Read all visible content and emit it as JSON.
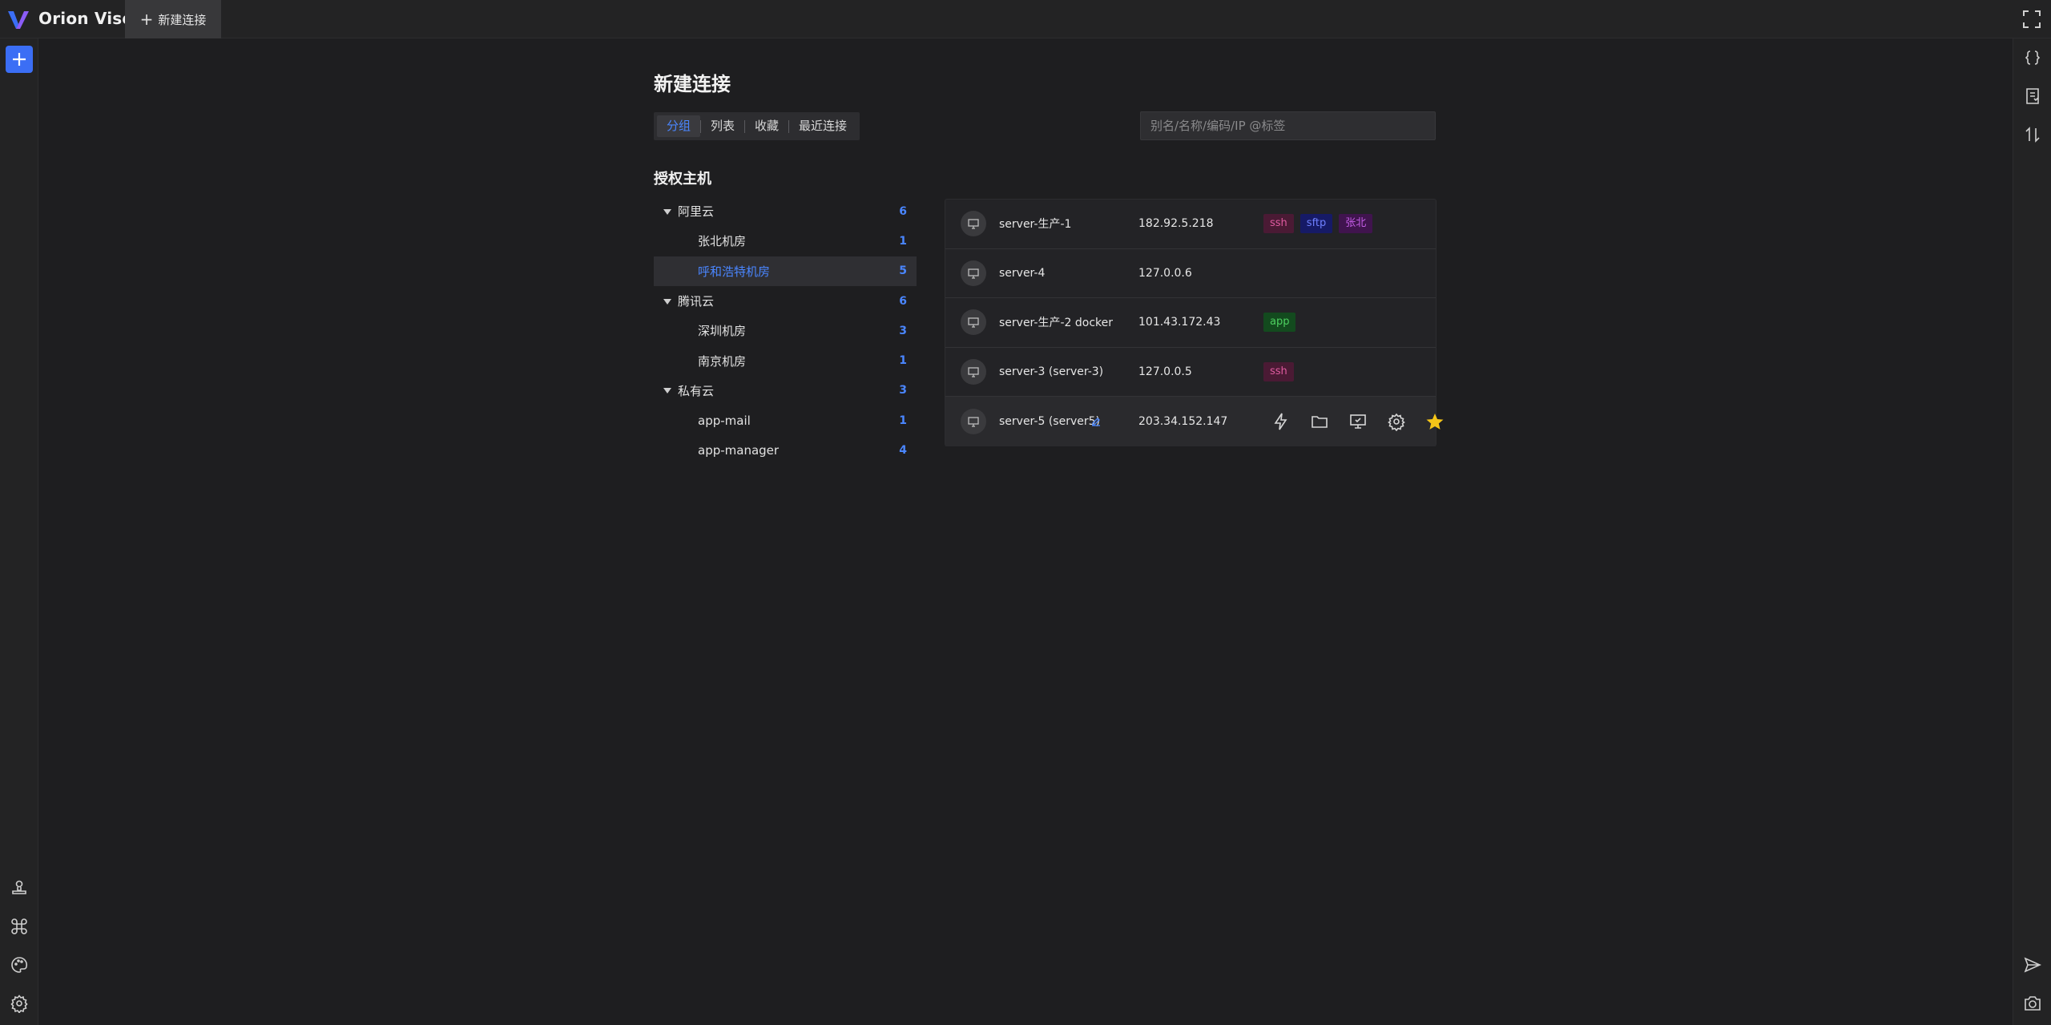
{
  "app": {
    "title": "Orion Visor"
  },
  "tabs": [
    {
      "label": "新建连接"
    }
  ],
  "page": {
    "title": "新建连接"
  },
  "view_tabs": [
    {
      "label": "分组",
      "active": true
    },
    {
      "label": "列表",
      "active": false
    },
    {
      "label": "收藏",
      "active": false
    },
    {
      "label": "最近连接",
      "active": false
    }
  ],
  "search": {
    "placeholder": "别名/名称/编码/IP @标签",
    "value": ""
  },
  "section": {
    "title": "授权主机"
  },
  "tree": [
    {
      "label": "阿里云",
      "count": "6",
      "level": "parent",
      "expanded": true
    },
    {
      "label": "张北机房",
      "count": "1",
      "level": "child",
      "selected": false
    },
    {
      "label": "呼和浩特机房",
      "count": "5",
      "level": "child",
      "selected": true
    },
    {
      "label": "腾讯云",
      "count": "6",
      "level": "parent",
      "expanded": true
    },
    {
      "label": "深圳机房",
      "count": "3",
      "level": "child",
      "selected": false
    },
    {
      "label": "南京机房",
      "count": "1",
      "level": "child",
      "selected": false
    },
    {
      "label": "私有云",
      "count": "3",
      "level": "parent",
      "expanded": true
    },
    {
      "label": "app-mail",
      "count": "1",
      "level": "child",
      "selected": false
    },
    {
      "label": "app-manager",
      "count": "4",
      "level": "child",
      "selected": false
    }
  ],
  "hosts": [
    {
      "name": "server-生产-1",
      "ip": "182.92.5.218",
      "tags": [
        "ssh",
        "sftp",
        "张北"
      ]
    },
    {
      "name": "server-4",
      "ip": "127.0.0.6",
      "tags": []
    },
    {
      "name": "server-生产-2  docker",
      "ip": "101.43.172.43",
      "tags": [
        "app"
      ]
    },
    {
      "name": "server-3 (server-3)",
      "ip": "127.0.0.5",
      "tags": [
        "ssh"
      ]
    },
    {
      "name": "server-5 (server5)",
      "ip": "203.34.152.147",
      "tags": [],
      "hovered": true,
      "favorite": true
    }
  ],
  "colors": {
    "accent": "#3b6ef5",
    "link": "#4a86ff",
    "star": "#f5c518"
  },
  "icons": {
    "left_rail": [
      "add-icon",
      "user-icon",
      "command-icon",
      "palette-icon",
      "settings-icon"
    ],
    "right_rail": [
      "braces-icon",
      "bookmark-icon",
      "sort-icon",
      "send-icon",
      "screenshot-icon"
    ],
    "host_actions": [
      "lightning-icon",
      "folder-icon",
      "monitor-icon",
      "settings-icon",
      "star-icon"
    ]
  }
}
